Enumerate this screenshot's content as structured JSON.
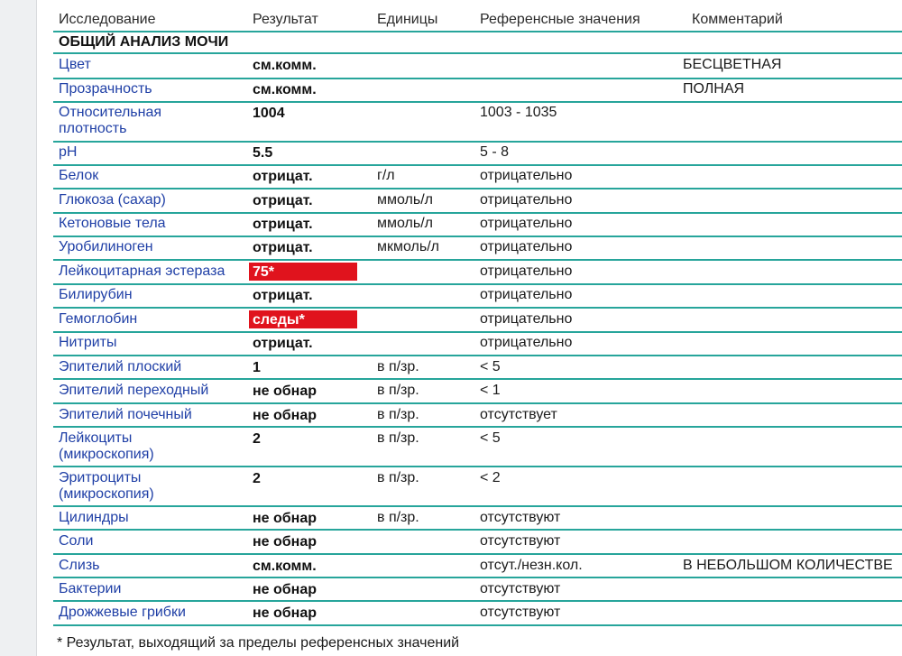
{
  "header": {
    "col_study": "Исследование",
    "col_result": "Результат",
    "col_units": "Единицы",
    "col_ref": "Референсные значения",
    "col_comment": "Комментарий"
  },
  "section_title": "ОБЩИЙ АНАЛИЗ МОЧИ",
  "rows": [
    {
      "name": "Цвет",
      "result": "см.комм.",
      "units": "",
      "ref": "",
      "comment": "БЕСЦВЕТНАЯ",
      "flag": false
    },
    {
      "name": "Прозрачность",
      "result": "см.комм.",
      "units": "",
      "ref": "",
      "comment": "ПОЛНАЯ",
      "flag": false
    },
    {
      "name": "Относительная",
      "name2": "плотность",
      "result": "1004",
      "units": "",
      "ref": "1003 - 1035",
      "comment": "",
      "flag": false
    },
    {
      "name": "pH",
      "result": "5.5",
      "units": "",
      "ref": "5 - 8",
      "comment": "",
      "flag": false
    },
    {
      "name": "Белок",
      "result": "отрицат.",
      "units": "г/л",
      "ref": "отрицательно",
      "comment": "",
      "flag": false
    },
    {
      "name": "Глюкоза (сахар)",
      "result": "отрицат.",
      "units": "ммоль/л",
      "ref": "отрицательно",
      "comment": "",
      "flag": false
    },
    {
      "name": "Кетоновые тела",
      "result": "отрицат.",
      "units": "ммоль/л",
      "ref": "отрицательно",
      "comment": "",
      "flag": false
    },
    {
      "name": "Уробилиноген",
      "result": "отрицат.",
      "units": "мкмоль/л",
      "ref": "отрицательно",
      "comment": "",
      "flag": false
    },
    {
      "name": "Лейкоцитарная эстераза",
      "result": "75*",
      "units": "",
      "ref": "отрицательно",
      "comment": "",
      "flag": true
    },
    {
      "name": "Билирубин",
      "result": "отрицат.",
      "units": "",
      "ref": "отрицательно",
      "comment": "",
      "flag": false
    },
    {
      "name": "Гемоглобин",
      "result": "следы*",
      "units": "",
      "ref": "отрицательно",
      "comment": "",
      "flag": true
    },
    {
      "name": "Нитриты",
      "result": "отрицат.",
      "units": "",
      "ref": "отрицательно",
      "comment": "",
      "flag": false
    },
    {
      "name": "Эпителий плоский",
      "result": "1",
      "units": "в п/зр.",
      "ref": "< 5",
      "comment": "",
      "flag": false
    },
    {
      "name": "Эпителий переходный",
      "result": "не обнар",
      "units": "в п/зр.",
      "ref": "< 1",
      "comment": "",
      "flag": false
    },
    {
      "name": "Эпителий почечный",
      "result": "не обнар",
      "units": "в п/зр.",
      "ref": "отсутствует",
      "comment": "",
      "flag": false
    },
    {
      "name": "Лейкоциты",
      "name2": "(микроскопия)",
      "result": "2",
      "units": "в п/зр.",
      "ref": "< 5",
      "comment": "",
      "flag": false
    },
    {
      "name": "Эритроциты",
      "name2": "(микроскопия)",
      "result": "2",
      "units": "в п/зр.",
      "ref": "< 2",
      "comment": "",
      "flag": false
    },
    {
      "name": "Цилиндры",
      "result": "не обнар",
      "units": "в п/зр.",
      "ref": "отсутствуют",
      "comment": "",
      "flag": false
    },
    {
      "name": "Соли",
      "result": "не обнар",
      "units": "",
      "ref": "отсутствуют",
      "comment": "",
      "flag": false
    },
    {
      "name": "Слизь",
      "result": "см.комм.",
      "units": "",
      "ref": "отсут./незн.кол.",
      "comment": "В НЕБОЛЬШОМ КОЛИЧЕСТВЕ",
      "flag": false
    },
    {
      "name": "Бактерии",
      "result": "не обнар",
      "units": "",
      "ref": "отсутствуют",
      "comment": "",
      "flag": false
    },
    {
      "name": "Дрожжевые грибки",
      "result": "не обнар",
      "units": "",
      "ref": "отсутствуют",
      "comment": "",
      "flag": false
    }
  ],
  "footnote": "* Результат, выходящий за пределы референсных значений",
  "colors": {
    "rule": "#27a59b",
    "name_text": "#1f3fa6",
    "flag_bg": "#e0131d"
  }
}
